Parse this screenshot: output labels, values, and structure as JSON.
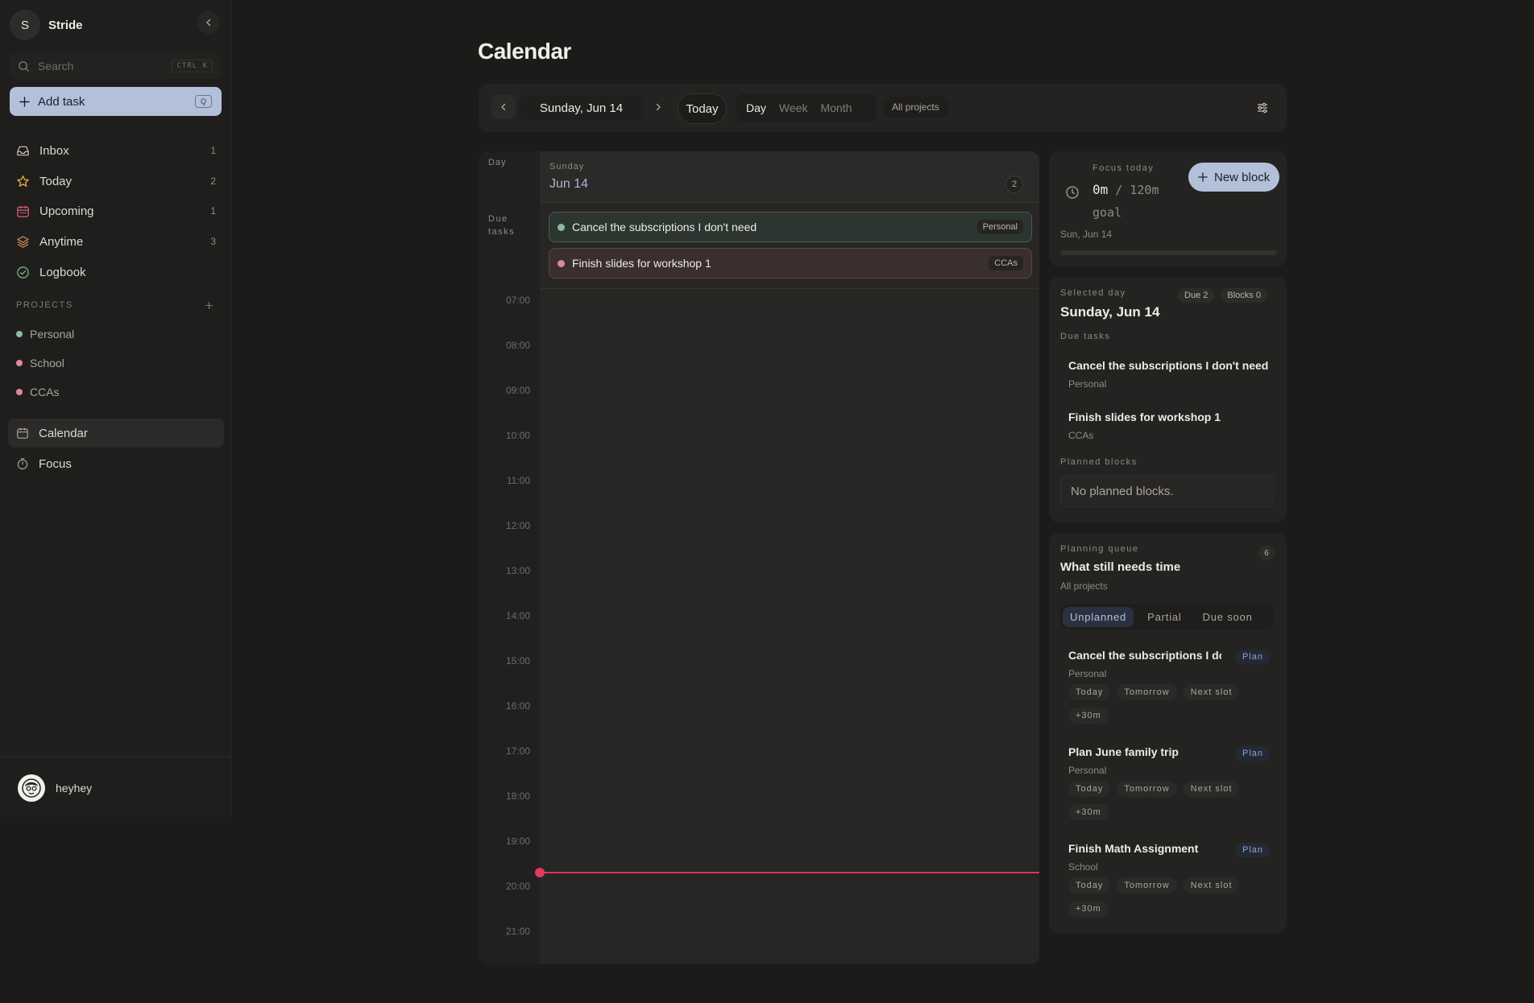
{
  "app": {
    "initial": "S",
    "name": "Stride"
  },
  "search": {
    "placeholder": "Search",
    "shortcut": "CTRL K"
  },
  "add_task": {
    "label": "Add task",
    "shortcut": "Q"
  },
  "nav": [
    {
      "label": "Inbox",
      "count": "1",
      "icon": "inbox-icon"
    },
    {
      "label": "Today",
      "count": "2",
      "icon": "star-icon"
    },
    {
      "label": "Upcoming",
      "count": "1",
      "icon": "calendar-icon"
    },
    {
      "label": "Anytime",
      "count": "3",
      "icon": "layers-icon"
    },
    {
      "label": "Logbook",
      "count": "",
      "icon": "check-circle-icon"
    }
  ],
  "projects_heading": "PROJECTS",
  "projects": [
    {
      "label": "Personal",
      "color": "#8fb9a4"
    },
    {
      "label": "School",
      "color": "#d98b9b"
    },
    {
      "label": "CCAs",
      "color": "#d98b9b"
    }
  ],
  "nav2": [
    {
      "label": "Calendar",
      "icon": "calendar-icon"
    },
    {
      "label": "Focus",
      "icon": "timer-icon"
    }
  ],
  "user": {
    "name": "heyhey"
  },
  "page": {
    "title": "Calendar"
  },
  "toolbar": {
    "date": "Sunday, Jun 14",
    "today": "Today",
    "views": [
      "Day",
      "Week",
      "Month"
    ],
    "active_view": "Day",
    "project_filter": "All projects"
  },
  "calendar": {
    "gutter_day": "Day",
    "gutter_due": "Due tasks",
    "weekday": "Sunday",
    "date": "Jun 14",
    "due_count": "2",
    "due_tasks": [
      {
        "title": "Cancel the subscriptions I don't need",
        "tag": "Personal",
        "color": "#8fb9a4",
        "bg": "#2d3530",
        "border": "#4b5a51"
      },
      {
        "title": "Finish slides for workshop 1",
        "tag": "CCAs",
        "color": "#d98b9b",
        "bg": "#3b2e2f",
        "border": "#5c4548"
      }
    ],
    "hours": [
      "07:00",
      "08:00",
      "09:00",
      "10:00",
      "11:00",
      "12:00",
      "13:00",
      "14:00",
      "15:00",
      "16:00",
      "17:00",
      "18:00",
      "19:00",
      "20:00",
      "21:00"
    ],
    "now_color": "#e03a5e"
  },
  "focus": {
    "label": "Focus today",
    "done": "0m",
    "goal": "/ 120m goal",
    "new_block": "New block",
    "date": "Sun, Jun 14",
    "progress": 0
  },
  "selected_day": {
    "label": "Selected day",
    "date": "Sunday, Jun 14",
    "due_pill": "Due 2",
    "blocks_pill": "Blocks 0",
    "due_label": "Due tasks",
    "tasks": [
      {
        "title": "Cancel the subscriptions I don't need",
        "project": "Personal"
      },
      {
        "title": "Finish slides for workshop 1",
        "project": "CCAs"
      }
    ],
    "planned_label": "Planned blocks",
    "empty": "No planned blocks."
  },
  "queue": {
    "label": "Planning queue",
    "title": "What still needs time",
    "sub": "All projects",
    "count": "6",
    "tabs": [
      "Unplanned",
      "Partial",
      "Due soon"
    ],
    "active_tab": "Unplanned",
    "items": [
      {
        "title": "Cancel the subscriptions I do...",
        "project": "Personal",
        "plan": "Plan",
        "actions": [
          "Today",
          "Tomorrow",
          "Next slot",
          "+30m"
        ]
      },
      {
        "title": "Plan June family trip",
        "project": "Personal",
        "plan": "Plan",
        "actions": [
          "Today",
          "Tomorrow",
          "Next slot",
          "+30m"
        ]
      },
      {
        "title": "Finish Math Assignment",
        "project": "School",
        "plan": "Plan",
        "actions": [
          "Today",
          "Tomorrow",
          "Next slot",
          "+30m"
        ]
      }
    ]
  },
  "colors": {
    "accent": "#b3c0d9",
    "background": "#1c1b19",
    "now": "#e03a5e"
  }
}
